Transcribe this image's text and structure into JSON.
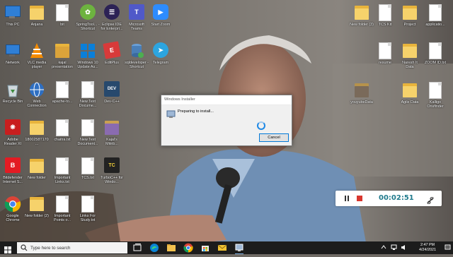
{
  "desktop": {
    "icons": [
      {
        "label": "This PC",
        "icon": "this-pc-icon"
      },
      {
        "label": "Anjana",
        "icon": "folder-icon"
      },
      {
        "label": "bit",
        "icon": "file-icon"
      },
      {
        "label": "kajal",
        "icon": "file-icon"
      },
      {
        "label": "SpringTool... - Shortcut",
        "icon": "spring-tool-icon"
      },
      {
        "label": "Eclipse IDE for Enterpri...",
        "icon": "eclipse-icon"
      },
      {
        "label": "Microsoft Teams",
        "icon": "teams-icon"
      },
      {
        "label": "Start Zoom",
        "icon": "zoom-icon"
      },
      {
        "label": "Network",
        "icon": "network-icon"
      },
      {
        "label": "VLC media player",
        "icon": "vlc-icon"
      },
      {
        "label": "kajal presentation",
        "icon": "presentation-icon"
      },
      {
        "label": "Windows 10 Update As...",
        "icon": "windows-update-icon"
      },
      {
        "label": "EditPlus",
        "icon": "editplus-icon"
      },
      {
        "label": "sqldeveloper - Shortcut",
        "icon": "sqldeveloper-icon"
      },
      {
        "label": "Telegram",
        "icon": "telegram-icon"
      },
      {
        "label": "Recycle Bin",
        "icon": "recycle-bin-icon"
      },
      {
        "label": "Web Connection",
        "icon": "web-connection-icon"
      },
      {
        "label": "apache-to...",
        "icon": "file-icon"
      },
      {
        "label": "New Text Docume...",
        "icon": "text-document-icon"
      },
      {
        "label": "Dev-C++",
        "icon": "dev-cpp-icon"
      },
      {
        "label": "Adobe Reader XI",
        "icon": "adobe-reader-icon"
      },
      {
        "label": "1800258T170...",
        "icon": "folder-icon"
      },
      {
        "label": "chaitra.txt",
        "icon": "text-document-icon"
      },
      {
        "label": "New Text Document...",
        "icon": "text-document-icon"
      },
      {
        "label": "Kajal's Mitrib...",
        "icon": "file-icon"
      },
      {
        "label": "Bitdefender Internet S...",
        "icon": "bitdefender-icon"
      },
      {
        "label": "New folder",
        "icon": "folder-icon"
      },
      {
        "label": "Important Links.txt",
        "icon": "text-document-icon"
      },
      {
        "label": "TCS.txt",
        "icon": "text-document-icon"
      },
      {
        "label": "TurboC++ for Windo...",
        "icon": "turbo-cpp-icon"
      },
      {
        "label": "Google Chrome",
        "icon": "chrome-icon"
      },
      {
        "label": "New folder (2)",
        "icon": "folder-icon"
      },
      {
        "label": "Important Points o...",
        "icon": "text-document-icon"
      },
      {
        "label": "Links For Study.txt",
        "icon": "text-document-icon"
      },
      {
        "label": "New folder (3)",
        "icon": "folder-icon"
      },
      {
        "label": "TCS Kit",
        "icon": "file-icon"
      },
      {
        "label": "Project",
        "icon": "folder-icon"
      },
      {
        "label": "applicatio...",
        "icon": "file-icon"
      },
      {
        "label": "resume",
        "icon": "file-icon"
      },
      {
        "label": "Naresh It Data",
        "icon": "folder-icon"
      },
      {
        "label": "ZOOM ID.txt",
        "icon": "text-document-icon"
      },
      {
        "label": "youyubeData",
        "icon": "folder-icon"
      },
      {
        "label": "Agile Data",
        "icon": "folder-icon"
      },
      {
        "label": "Kalligo Onsfinder",
        "icon": "file-icon"
      }
    ]
  },
  "installer": {
    "title": "Windows Installer",
    "message": "Preparing to install...",
    "cancel_label": "Cancel"
  },
  "recorder": {
    "time": "00:02:51"
  },
  "taskbar": {
    "search_placeholder": "Type here to search",
    "time": "2:47 PM",
    "date": "4/24/2021",
    "apps": [
      "task-view-icon",
      "edge-icon",
      "file-explorer-icon",
      "chrome-icon",
      "store-icon",
      "mail-icon",
      "installer-icon"
    ]
  }
}
